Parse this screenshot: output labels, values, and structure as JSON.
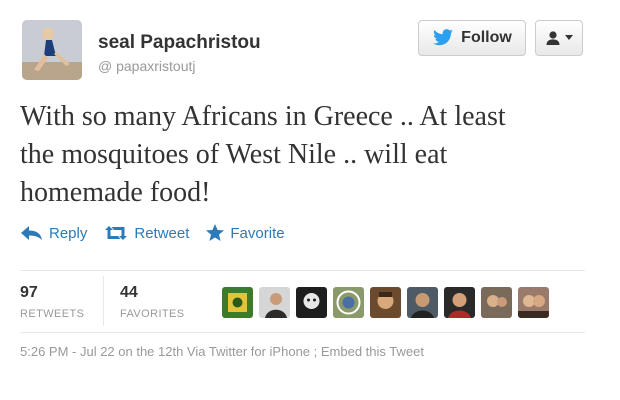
{
  "author": {
    "name": "seal Papachristou",
    "handle": "papaxristoutj",
    "avatar_icon": "profile-photo"
  },
  "header": {
    "follow_label": "Follow",
    "follow_icon": "twitter-bird-icon",
    "user_menu_icon": "user-dropdown-icon"
  },
  "tweet": {
    "line1": "With so many Africans in Greece .. At least",
    "line2": "the mosquitoes of West Nile .. will eat",
    "line3": "homemade food!"
  },
  "actions": {
    "reply_label": "Reply",
    "retweet_label": "Retweet",
    "favorite_label": "Favorite"
  },
  "stats": {
    "retweets_count": "97",
    "retweets_label": "RETWEETS",
    "favorites_count": "44",
    "favorites_label": "FAVORITES"
  },
  "meta": {
    "text": "5:26 PM - Jul 22 on the 12th Via Twitter for iPhone ; Embed this Tweet"
  },
  "colors": {
    "link": "#2b7bb9",
    "text": "#333333",
    "muted": "#999999"
  }
}
